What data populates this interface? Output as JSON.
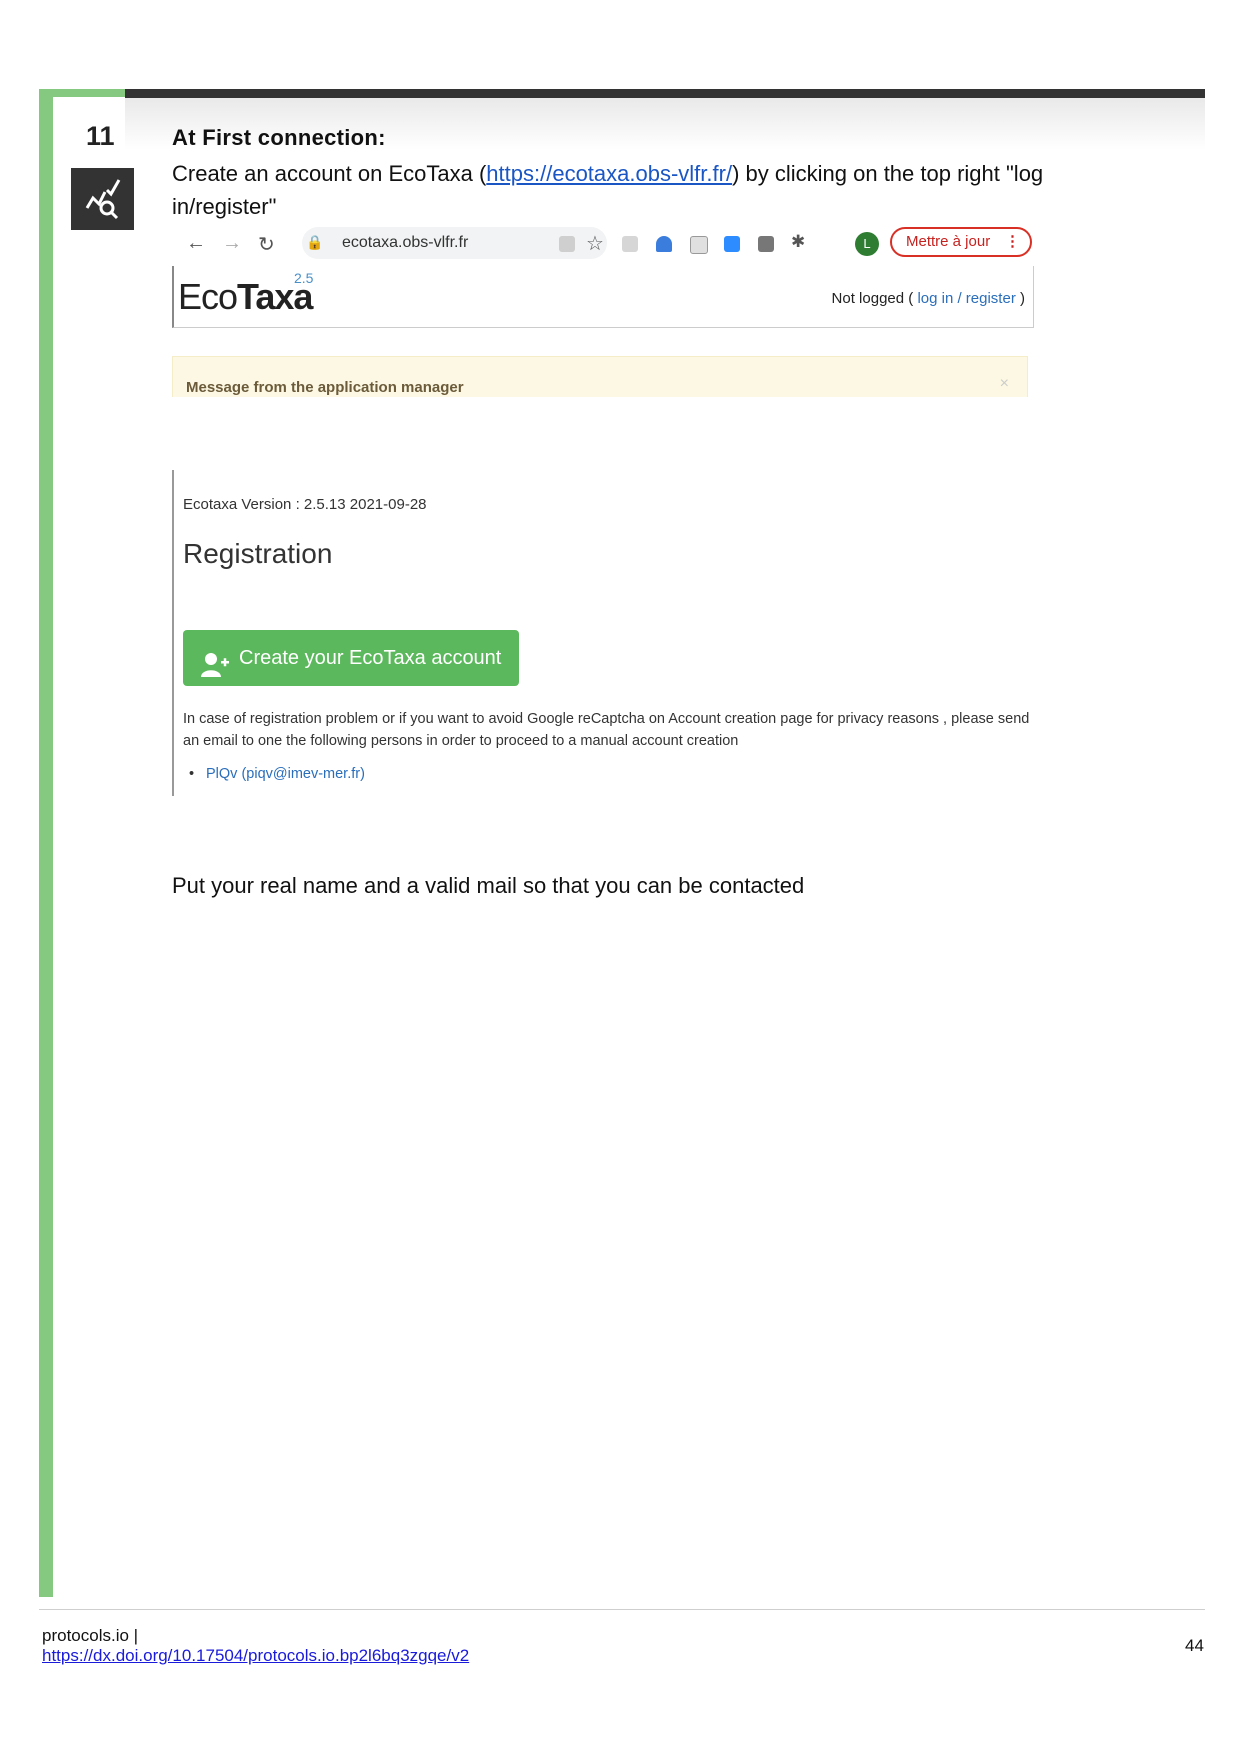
{
  "step": {
    "number": "11",
    "title": "At First connection:",
    "text_before_link": "Create an account on EcoTaxa  (",
    "link": "https://ecotaxa.obs-vlfr.fr/",
    "text_after_link": ") by clicking on the top right \"log in/register\"",
    "icon": "analysis-chart-search-icon"
  },
  "screenshot_browser": {
    "url": "ecotaxa.obs-vlfr.fr",
    "avatar_letter": "L",
    "update_button": "Mettre à jour",
    "update_menu": "⋮",
    "logo_eco": "EcoTaxa",
    "logo_eco_part": "Eco",
    "logo_taxa_part": "Taxa",
    "logo_version": "2.5",
    "status_prefix": "Not logged ( ",
    "status_link": "log in / register",
    "status_suffix": " )",
    "message_title": "Message from the application manager",
    "message_close": "×"
  },
  "screenshot_registration": {
    "version": "Ecotaxa Version : 2.5.13 2021-09-28",
    "title": "Registration",
    "create_button": "Create your EcoTaxa account",
    "note": "In case of registration problem or if you want to avoid Google reCaptcha on Account creation page for privacy reasons , please send an email to one the following persons in order to proceed to a manual account creation",
    "contact": "PlQv (piqv@imev-mer.fr)"
  },
  "final_text": "Put your real name and a valid mail so that you can be contacted",
  "footer": {
    "site": "protocols.io |",
    "doi_link": "https://dx.doi.org/10.17504/protocols.io.bp2l6bq3zgqe/v2",
    "page": "44"
  },
  "colors": {
    "accent_green": "#84c97f",
    "dark_bar": "#333333",
    "button_green": "#5cb85c",
    "link_blue": "#1a56c4"
  }
}
